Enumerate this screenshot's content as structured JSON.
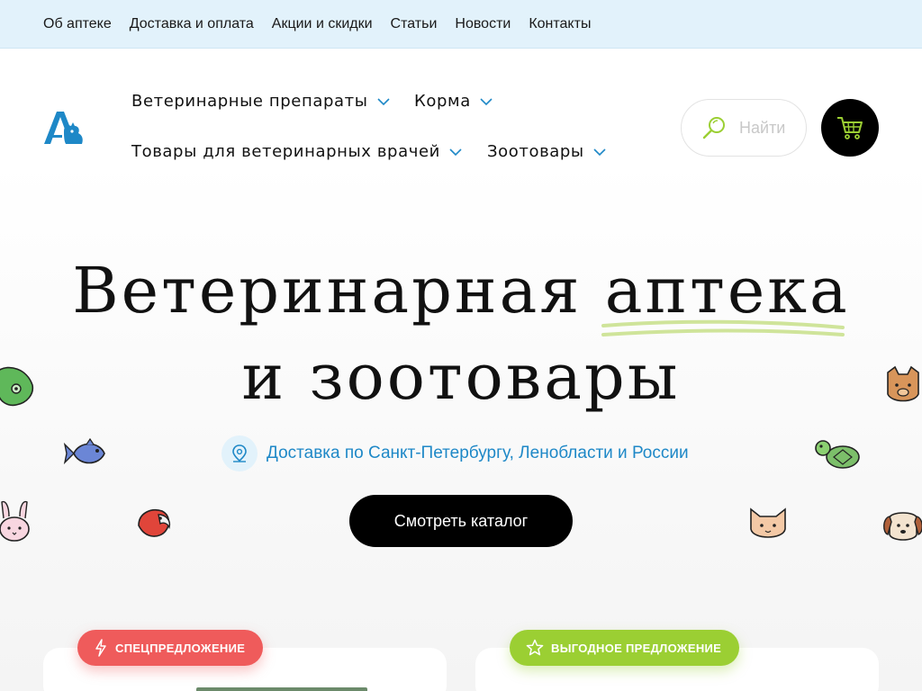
{
  "topbar": {
    "links": [
      "Об аптеке",
      "Доставка и оплата",
      "Акции и скидки",
      "Статьи",
      "Новости",
      "Контакты"
    ]
  },
  "header": {
    "nav": [
      "Ветеринарные препараты",
      "Корма",
      "Товары для ветеринарных врачей",
      "Зоотовары"
    ],
    "search_placeholder": "Найти",
    "icons": [
      "logo-a-pet",
      "search-icon",
      "cart-icon",
      "chevron-down-icon"
    ]
  },
  "hero": {
    "title_part1": "Ветеринарная",
    "title_highlight": "аптека",
    "title_line2": "и зоотовары",
    "delivery_text": "Доставка по Санкт-Петербургу, Ленобласти и России",
    "catalog_button": "Смотреть каталог"
  },
  "promo": {
    "special_badge": "СПЕЦПРЕДЛОЖЕНИЕ",
    "profit_badge": "ВЫГОДНОЕ ПРЕДЛОЖЕНИЕ"
  },
  "colors": {
    "topbar_bg": "#e2f2fb",
    "accent_blue": "#1e88c7",
    "accent_green": "#9bcf33",
    "accent_red": "#ef5b5b",
    "button_black": "#000000"
  }
}
